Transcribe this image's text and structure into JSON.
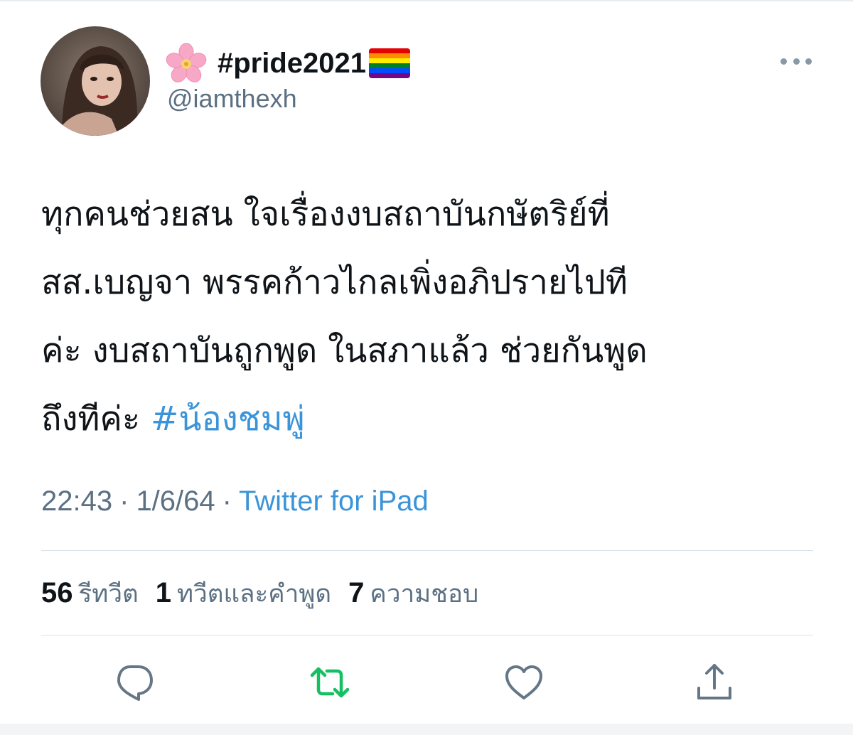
{
  "user": {
    "display_name": "#pride2021",
    "handle": "@iamthexh",
    "name_prefix_icon": "cherry-blossom-icon",
    "name_suffix_icon": "rainbow-flag-icon"
  },
  "tweet": {
    "lines": [
      "ทุกคนช่วยสน ใจเรื่องงบสถาบันกษัตริย์ที่",
      "สส.เบญจา พรรคก้าวไกลเพิ่งอภิปรายไปที",
      "ค่ะ งบสถาบันถูกพูด ในสภาแล้ว ช่วยกันพูด"
    ],
    "last_line_text": "ถึงทีค่ะ ",
    "hashtag": "#น้องชมพู่"
  },
  "meta": {
    "time": "22:43",
    "date": "1/6/64",
    "separator": "·",
    "source": "Twitter for iPad"
  },
  "stats": {
    "retweets_count": "56",
    "retweets_label": "รีทวีต",
    "quotes_count": "1",
    "quotes_label": "ทวีตและคำพูด",
    "likes_count": "7",
    "likes_label": "ความชอบ"
  },
  "colors": {
    "link": "#3b94d9",
    "secondary_text": "#5b7083",
    "retweet_green": "#17bf63",
    "icon_gray": "#657786"
  }
}
